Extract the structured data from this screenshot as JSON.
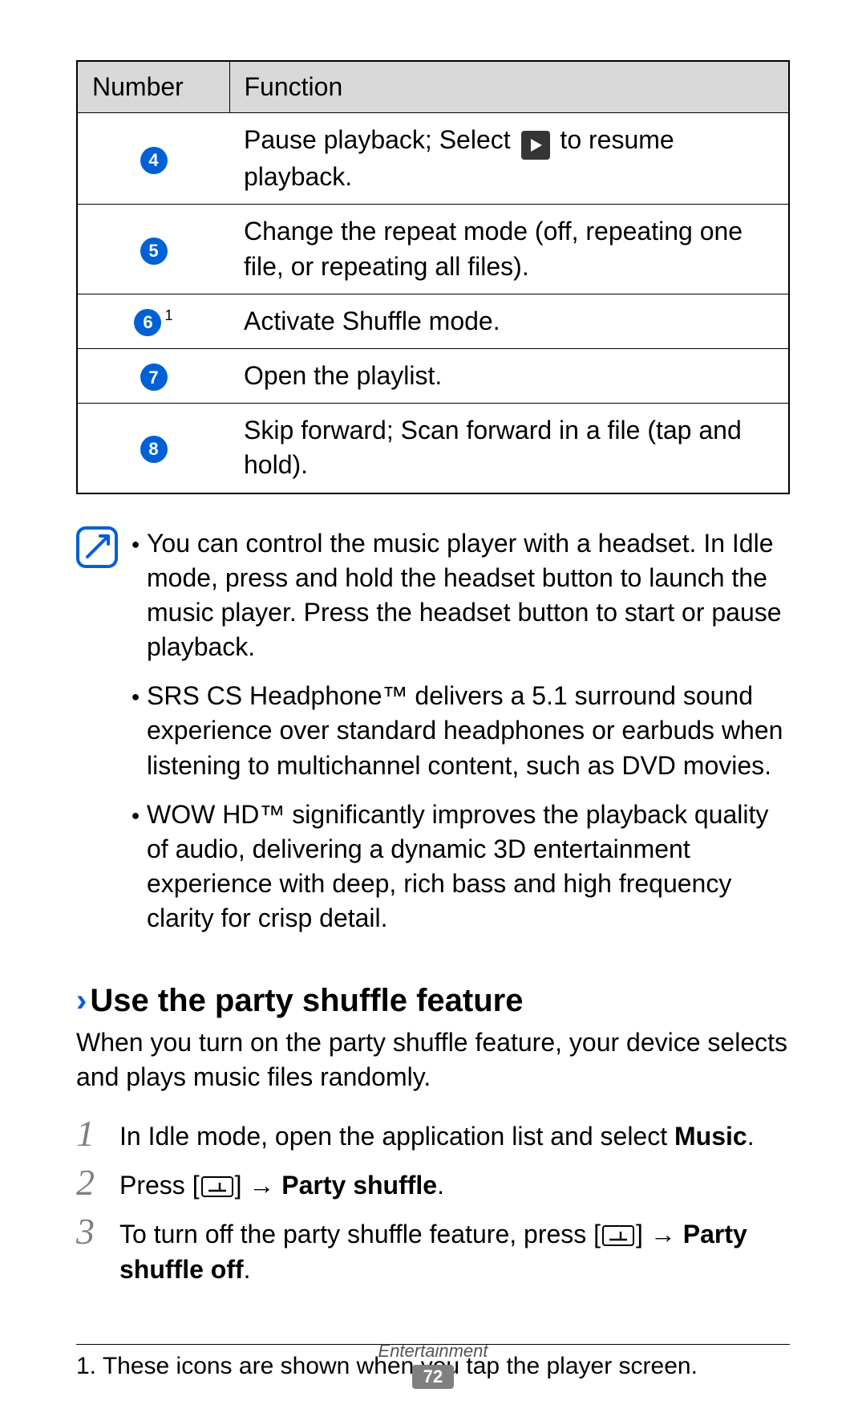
{
  "table": {
    "headers": {
      "number": "Number",
      "function": "Function"
    },
    "rows": [
      {
        "num": "4",
        "sup": "",
        "func_pre": "Pause playback; Select ",
        "func_post": " to resume playback.",
        "has_play_icon": true
      },
      {
        "num": "5",
        "sup": "",
        "func": "Change the repeat mode (off, repeating one file, or repeating all files)."
      },
      {
        "num": "6",
        "sup": "1",
        "func": "Activate Shuffle mode."
      },
      {
        "num": "7",
        "sup": "",
        "func": "Open the playlist."
      },
      {
        "num": "8",
        "sup": "",
        "func": "Skip forward; Scan forward in a file (tap and hold)."
      }
    ]
  },
  "notes": [
    "You can control the music player with a headset. In Idle mode, press and hold the headset button to launch the music player. Press the headset button to start or pause playback.",
    "SRS CS Headphone™ delivers a 5.1 surround sound experience over standard headphones or earbuds when listening to multichannel content, such as DVD movies.",
    "WOW HD™ significantly improves the playback quality of audio, delivering a dynamic 3D entertainment experience with deep, rich bass and high frequency clarity for crisp detail."
  ],
  "section": {
    "chevron": "›",
    "title": "Use the party shuffle feature",
    "intro": "When you turn on the party shuffle feature, your device selects and plays music files randomly."
  },
  "steps": {
    "s1": {
      "num": "1",
      "pre": "In Idle mode, open the application list and select ",
      "bold": "Music",
      "post": "."
    },
    "s2": {
      "num": "2",
      "pre": "Press [",
      "mid": "] → ",
      "bold": "Party shuffle",
      "post": "."
    },
    "s3": {
      "num": "3",
      "pre": "To turn off the party shuffle feature, press [",
      "mid": "] → ",
      "bold": "Party shuffle off",
      "post": "."
    }
  },
  "footnote": "1. These icons are shown when you tap the player screen.",
  "footer": {
    "category": "Entertainment",
    "page": "72"
  }
}
